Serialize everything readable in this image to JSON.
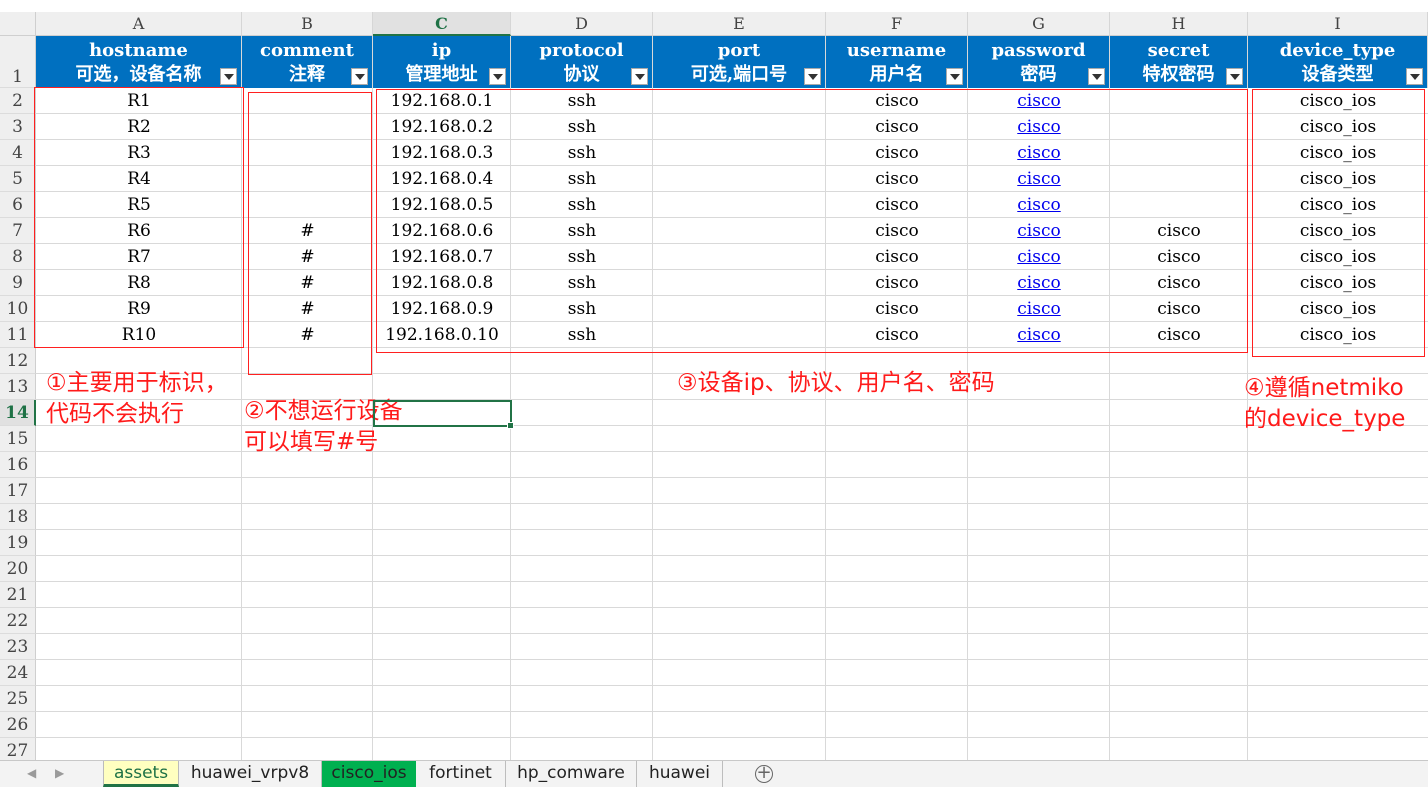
{
  "columns": [
    "A",
    "B",
    "C",
    "D",
    "E",
    "F",
    "G",
    "H",
    "I"
  ],
  "selected_column": "C",
  "selected_row": "14",
  "row_numbers": [
    "1",
    "2",
    "3",
    "4",
    "5",
    "6",
    "7",
    "8",
    "9",
    "10",
    "11",
    "12",
    "13",
    "14",
    "15",
    "16",
    "17",
    "18",
    "19",
    "20",
    "21",
    "22",
    "23",
    "24",
    "25",
    "26",
    "27"
  ],
  "headers": [
    {
      "key": "hostname",
      "label": "可选，设备名称"
    },
    {
      "key": "comment",
      "label": "注释"
    },
    {
      "key": "ip",
      "label": "管理地址"
    },
    {
      "key": "protocol",
      "label": "协议"
    },
    {
      "key": "port",
      "label": "可选,端口号"
    },
    {
      "key": "username",
      "label": "用户名"
    },
    {
      "key": "password",
      "label": "密码"
    },
    {
      "key": "secret",
      "label": "特权密码"
    },
    {
      "key": "device_type",
      "label": "设备类型"
    }
  ],
  "rows": [
    [
      "R1",
      "",
      "192.168.0.1",
      "ssh",
      "",
      "cisco",
      "cisco",
      "",
      "cisco_ios"
    ],
    [
      "R2",
      "",
      "192.168.0.2",
      "ssh",
      "",
      "cisco",
      "cisco",
      "",
      "cisco_ios"
    ],
    [
      "R3",
      "",
      "192.168.0.3",
      "ssh",
      "",
      "cisco",
      "cisco",
      "",
      "cisco_ios"
    ],
    [
      "R4",
      "",
      "192.168.0.4",
      "ssh",
      "",
      "cisco",
      "cisco",
      "",
      "cisco_ios"
    ],
    [
      "R5",
      "",
      "192.168.0.5",
      "ssh",
      "",
      "cisco",
      "cisco",
      "",
      "cisco_ios"
    ],
    [
      "R6",
      "#",
      "192.168.0.6",
      "ssh",
      "",
      "cisco",
      "cisco",
      "cisco",
      "cisco_ios"
    ],
    [
      "R7",
      "#",
      "192.168.0.7",
      "ssh",
      "",
      "cisco",
      "cisco",
      "cisco",
      "cisco_ios"
    ],
    [
      "R8",
      "#",
      "192.168.0.8",
      "ssh",
      "",
      "cisco",
      "cisco",
      "cisco",
      "cisco_ios"
    ],
    [
      "R9",
      "#",
      "192.168.0.9",
      "ssh",
      "",
      "cisco",
      "cisco",
      "cisco",
      "cisco_ios"
    ],
    [
      "R10",
      "#",
      "192.168.0.10",
      "ssh",
      "",
      "cisco",
      "cisco",
      "cisco",
      "cisco_ios"
    ]
  ],
  "annotations": {
    "a1_line1": "①主要用于标识，",
    "a1_line2": "代码不会执行",
    "a2_line1": "②不想运行设备",
    "a2_line2": "可以填写#号",
    "a3": "③设备ip、协议、用户名、密码",
    "a4_line1": "④遵循netmiko",
    "a4_line2": "的device_type"
  },
  "sheet_tabs": [
    {
      "label": "assets",
      "state": "active"
    },
    {
      "label": "huawei_vrpv8",
      "state": "normal"
    },
    {
      "label": "cisco_ios",
      "state": "green"
    },
    {
      "label": "fortinet",
      "state": "normal"
    },
    {
      "label": "hp_comware",
      "state": "normal"
    },
    {
      "label": "huawei",
      "state": "normal"
    }
  ],
  "colors": {
    "header_fill": "#0070c0",
    "annotation_red": "#ff1a1a",
    "link_blue": "#0000ee",
    "tab_active": "#ffffc0",
    "tab_green": "#00b050",
    "selection_green": "#217346"
  },
  "icons": {
    "filter_dropdown": "dropdown-arrow-icon",
    "tab_nav_left": "chevron-left-icon",
    "tab_nav_right": "chevron-right-icon",
    "add_sheet": "plus-circle-icon"
  }
}
